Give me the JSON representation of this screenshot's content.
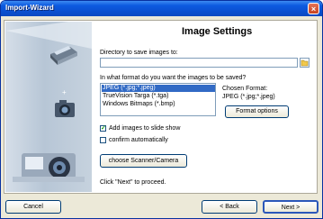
{
  "window": {
    "title": "Import-Wizard"
  },
  "header": {
    "title": "Image Settings"
  },
  "directory": {
    "label": "Directory to save images to:",
    "value": ""
  },
  "format": {
    "question": "In what format do you want the images to be saved?",
    "options": [
      "JPEG (*.jpg;*.jpeg)",
      "TrueVision Targa (*.tga)",
      "Windows Bitmaps (*.bmp)"
    ],
    "selected_index": 0,
    "chosen_label": "Chosen Format:",
    "chosen_value": "JPEG (*.jpg;*.jpeg)",
    "options_button": "Format options"
  },
  "checkboxes": {
    "slideshow": {
      "label": "Add images to slide show",
      "checked": true
    },
    "confirm": {
      "label": "confirm automatically",
      "checked": false
    }
  },
  "scanner_button": "choose Scanner/Camera",
  "hint": "Click \"Next\" to proceed.",
  "footer": {
    "cancel": "Cancel",
    "back": "< Back",
    "next": "Next >"
  },
  "colors": {
    "titlebar": "#0a4fd0",
    "selection": "#316ac5",
    "dialog_bg": "#ece9d8"
  }
}
